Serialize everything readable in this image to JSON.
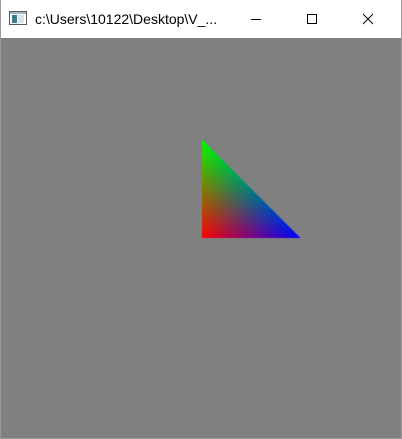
{
  "window": {
    "title": "c:\\Users\\10122\\Desktop\\V_..."
  },
  "icons": {
    "app": "app-window-icon",
    "minimize": "minimize-icon",
    "maximize": "maximize-icon",
    "close": "close-icon"
  },
  "colors": {
    "title_bar": "#ffffff",
    "client_background": "#808080",
    "vertex_top": "#00ff00",
    "vertex_bottom_left": "#ff0000",
    "vertex_bottom_right": "#0000ff"
  },
  "scene": {
    "shape": "triangle",
    "vertex_colors": [
      "#00ff00",
      "#ff0000",
      "#0000ff"
    ]
  }
}
